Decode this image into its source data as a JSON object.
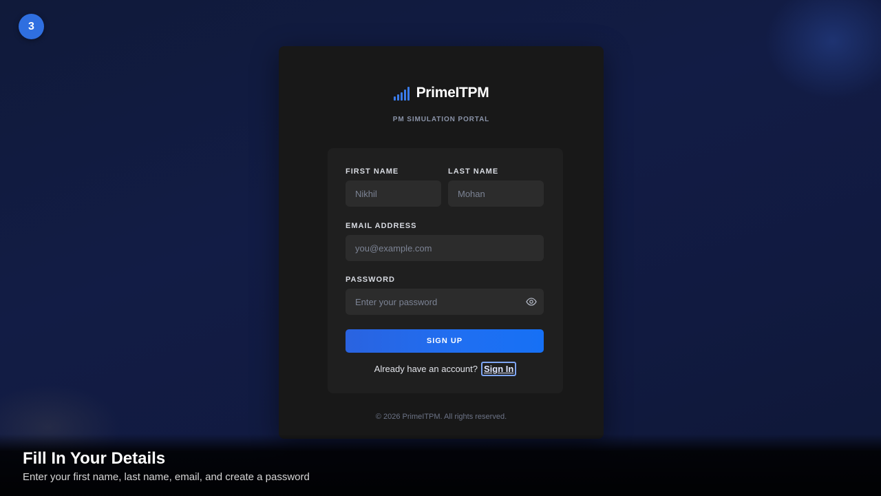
{
  "step": {
    "number": "3"
  },
  "brand": {
    "name": "PrimeITPM",
    "subtitle": "PM SIMULATION PORTAL",
    "icon": "signal-bars-icon",
    "accent": "#3a7bea"
  },
  "form": {
    "first_name": {
      "label": "FIRST NAME",
      "placeholder": "Nikhil"
    },
    "last_name": {
      "label": "LAST NAME",
      "placeholder": "Mohan"
    },
    "email": {
      "label": "EMAIL ADDRESS",
      "placeholder": "you@example.com"
    },
    "password": {
      "label": "PASSWORD",
      "placeholder": "Enter your password",
      "toggle_icon": "eye-icon"
    },
    "submit_label": "SIGN UP",
    "signin_prompt": "Already have an account?",
    "signin_link": "Sign In"
  },
  "footer": {
    "copyright": "© 2026 PrimeITPM. All rights reserved."
  },
  "caption": {
    "title": "Fill In Your Details",
    "description": "Enter your first name, last name, email, and create a password"
  },
  "colors": {
    "primary_button": "#1f6ff2",
    "badge": "#2f6fe0",
    "card_bg": "#181818"
  }
}
